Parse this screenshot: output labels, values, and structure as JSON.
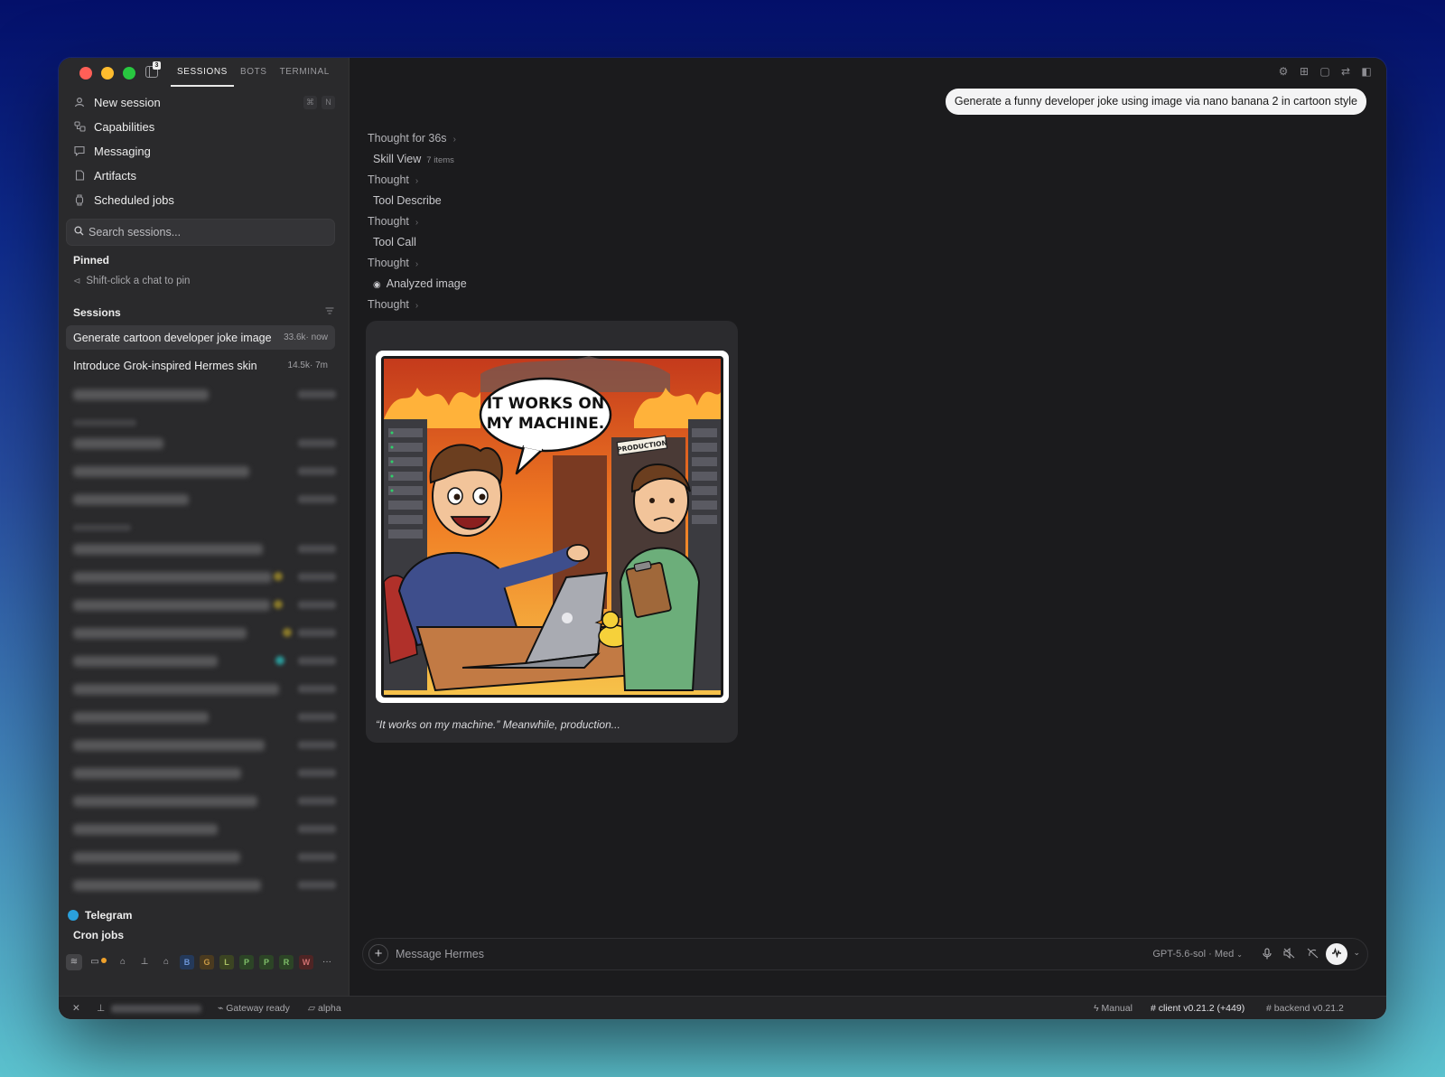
{
  "sidebar": {
    "tabs": [
      "SESSIONS",
      "BOTS",
      "TERMINAL"
    ],
    "notification_count": "3",
    "nav": [
      {
        "label": "New session",
        "icon": "person-icon"
      },
      {
        "label": "Capabilities",
        "icon": "capabilities-icon"
      },
      {
        "label": "Messaging",
        "icon": "chat-bubble-icon"
      },
      {
        "label": "Artifacts",
        "icon": "document-icon"
      },
      {
        "label": "Scheduled jobs",
        "icon": "watch-icon"
      }
    ],
    "shortcut": [
      "⌘",
      "N"
    ],
    "search_placeholder": "Search sessions...",
    "pinned_label": "Pinned",
    "pin_hint": "Shift-click a chat to pin",
    "sessions_label": "Sessions",
    "sessions": [
      {
        "title": "Generate cartoon developer joke image",
        "meta": "33.6k· now"
      },
      {
        "title": "Introduce Grok-inspired Hermes skin",
        "meta": "14.5k· 7m"
      }
    ],
    "footer": [
      "Telegram",
      "Cron jobs"
    ],
    "toolbar_letters": [
      "B",
      "G",
      "L",
      "P",
      "P",
      "R",
      "W"
    ],
    "toolbar_more": "···"
  },
  "chat": {
    "user_message": "Generate a funny developer joke using image via nano banana 2 in cartoon style",
    "trace": [
      {
        "label": "Thought for 36s",
        "type": "thought"
      },
      {
        "label": "Skill View",
        "count": "7 items",
        "type": "tool"
      },
      {
        "label": "Thought",
        "type": "thought"
      },
      {
        "label": "Tool Describe",
        "type": "tool"
      },
      {
        "label": "Thought",
        "type": "thought"
      },
      {
        "label": "Tool Call",
        "type": "tool"
      },
      {
        "label": "Thought",
        "type": "thought"
      },
      {
        "label": "Analyzed image",
        "type": "analyzed"
      },
      {
        "label": "Thought",
        "type": "thought"
      }
    ],
    "image": {
      "speech": [
        "IT WORKS ON",
        "MY MACHINE."
      ],
      "sign": "PRODUCTION"
    },
    "caption": "“It works on my machine.” Meanwhile, production..."
  },
  "composer": {
    "placeholder": "Message Hermes",
    "model": "GPT-5.6-sol · Med"
  },
  "statusbar": {
    "gateway": "Gateway ready",
    "folder": "alpha",
    "mode": "Manual",
    "client": "client v0.21.2 (+449)",
    "backend": "backend v0.21.2"
  }
}
